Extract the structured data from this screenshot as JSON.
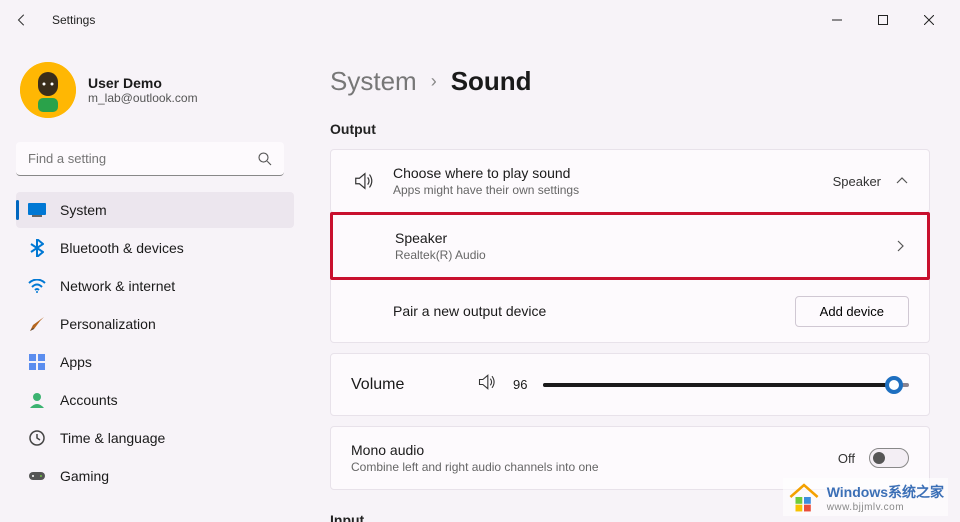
{
  "window": {
    "title": "Settings"
  },
  "user": {
    "name": "User Demo",
    "email": "m_lab@outlook.com"
  },
  "search": {
    "placeholder": "Find a setting"
  },
  "nav": {
    "items": [
      {
        "id": "system",
        "label": "System"
      },
      {
        "id": "bluetooth",
        "label": "Bluetooth & devices"
      },
      {
        "id": "network",
        "label": "Network & internet"
      },
      {
        "id": "personalization",
        "label": "Personalization"
      },
      {
        "id": "apps",
        "label": "Apps"
      },
      {
        "id": "accounts",
        "label": "Accounts"
      },
      {
        "id": "time",
        "label": "Time & language"
      },
      {
        "id": "gaming",
        "label": "Gaming"
      }
    ],
    "selected": "system"
  },
  "breadcrumb": {
    "parent": "System",
    "current": "Sound"
  },
  "sections": {
    "output": {
      "heading": "Output",
      "choose": {
        "title": "Choose where to play sound",
        "subtitle": "Apps might have their own settings",
        "value": "Speaker"
      },
      "speaker": {
        "title": "Speaker",
        "subtitle": "Realtek(R) Audio"
      },
      "pair": {
        "title": "Pair a new output device",
        "button": "Add device"
      },
      "volume": {
        "title": "Volume",
        "value": "96",
        "percent": 96
      },
      "mono": {
        "title": "Mono audio",
        "subtitle": "Combine left and right audio channels into one",
        "state": "Off"
      }
    },
    "input": {
      "heading": "Input"
    }
  },
  "watermark": {
    "brand": "Windows",
    "suffix": "系统之家",
    "url": "www.bjjmlv.com"
  }
}
